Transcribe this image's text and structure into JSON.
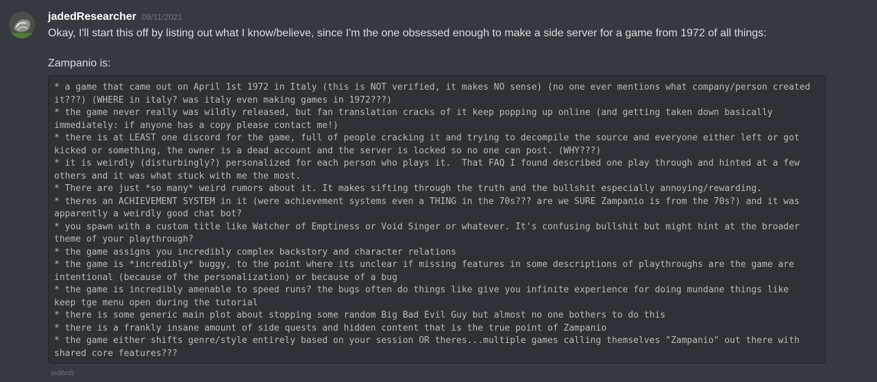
{
  "message": {
    "username": "jadedResearcher",
    "timestamp": "09/11/2021",
    "intro": "Okay, I'll start this off by listing out what I know/believe, since I'm the one obsessed enough to make a side server for a game from 1972 of all things:",
    "subheading": "Zampanio is:",
    "code_lines": [
      "* a game that came out on April 1st 1972 in Italy (this is NOT verified, it makes NO sense) (no one ever mentions what company/person created",
      "it???) (WHERE in italy? was italy even making games in 1972???)",
      "* the game never really was wildly released, but fan translation cracks of it keep popping up online (and getting taken down basically",
      "immediately: if anyone has a copy please contact me!)",
      "* there is at LEAST one discord for the game, full of people cracking it and trying to decompile the source and everyone either left or got",
      "kicked or something, the owner is a dead account and the server is locked so no one can post. (WHY???)",
      "* it is weirdly (disturbingly?) personalized for each person who plays it.  That FAQ I found described one play through and hinted at a few",
      "others and it was what stuck with me the most.",
      "* There are just *so many* weird rumors about it. It makes sifting through the truth and the bullshit especially annoying/rewarding.",
      "* theres an ACHIEVEMENT SYSTEM in it (were achievement systems even a THING in the 70s??? are we SURE Zampanio is from the 70s?) and it was",
      "apparently a weirdly good chat bot?",
      "* you spawn with a custom title like Watcher of Emptiness or Void Singer or whatever. It's confusing bullshit but might hint at the broader",
      "theme of your playthrough?",
      "* the game assigns you incredibly complex backstory and character relations",
      "* the game is *incredibly* buggy, to the point where its unclear if missing features in some descriptions of playthroughs are the game are",
      "intentional (because of the personalization) or because of a bug",
      "* the game is incredibly amenable to speed runs? the bugs often do things like give you infinite experience for doing mundane things like",
      "keep tge menu open during the tutorial",
      "* there is some generic main plot about stopping some random Big Bad Evil Guy but almost no one bothers to do this",
      "* there is a frankly insane amount of side quests and hidden content that is the true point of Zampanio",
      "* the game either shifts genre/style entirely based on your session OR theres...multiple games calling themselves \"Zampanio\" out there with",
      "shared core features???"
    ],
    "edited_label": "(edited)"
  }
}
